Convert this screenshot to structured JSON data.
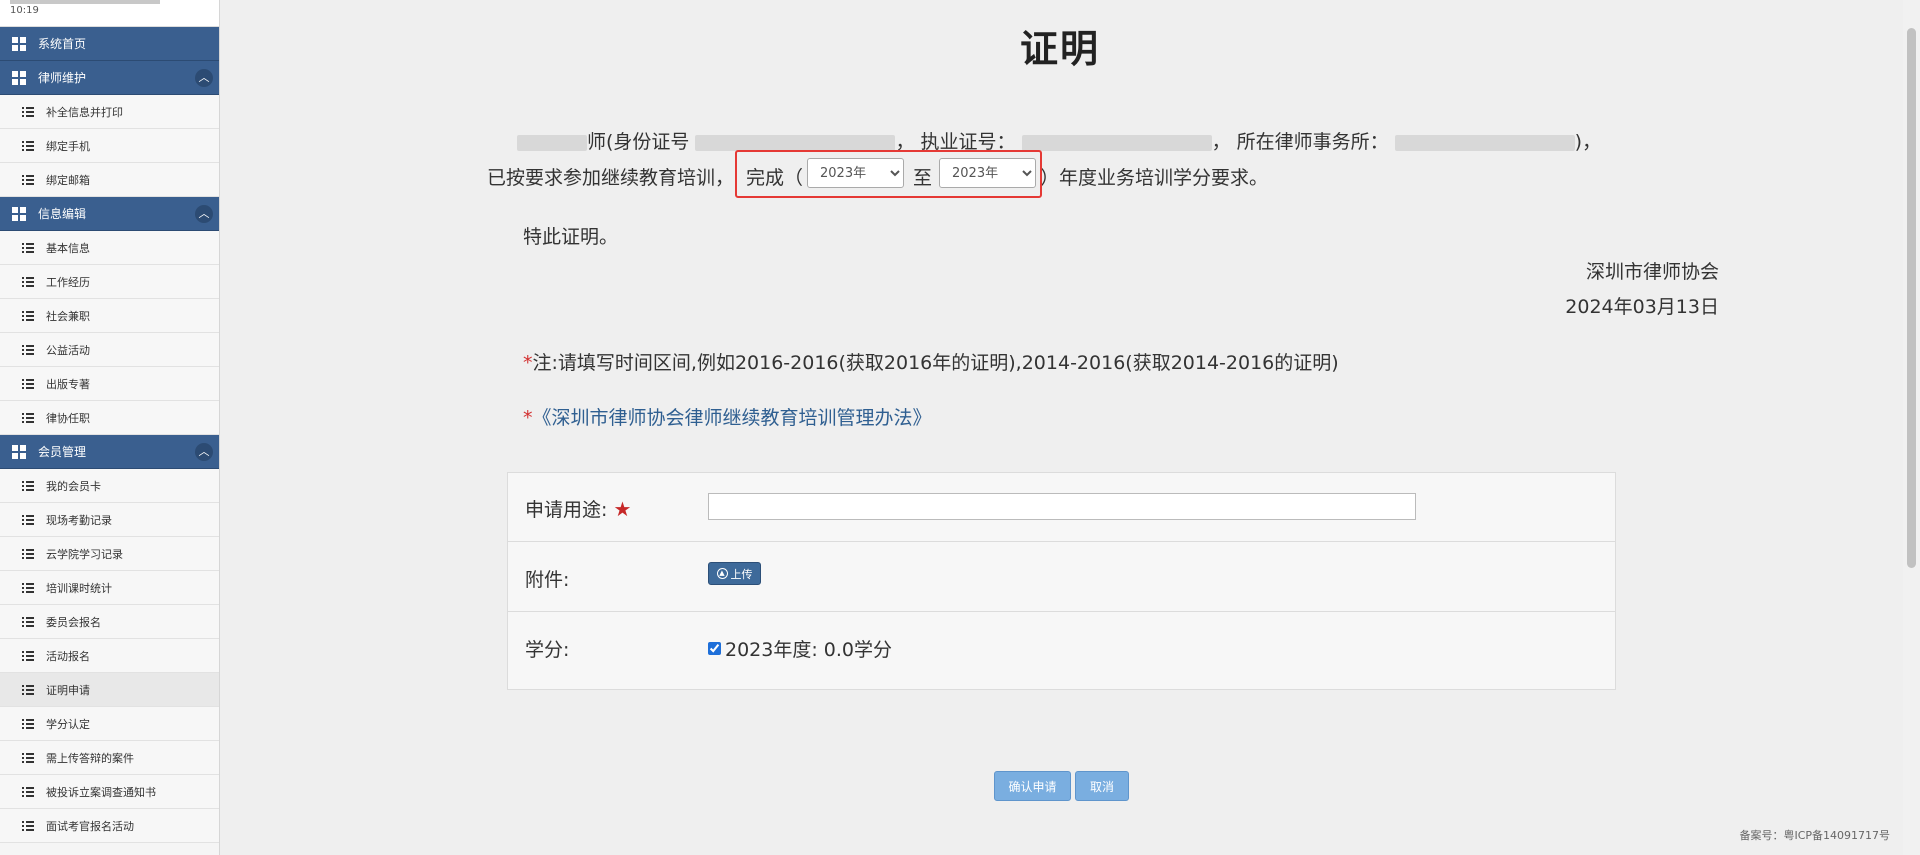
{
  "sidebar": {
    "top_time": "10:19",
    "home": "系统首页",
    "sections": [
      {
        "title": "律师维护",
        "items": [
          "补全信息并打印",
          "绑定手机",
          "绑定邮箱"
        ]
      },
      {
        "title": "信息编辑",
        "items": [
          "基本信息",
          "工作经历",
          "社会兼职",
          "公益活动",
          "出版专著",
          "律协任职"
        ]
      },
      {
        "title": "会员管理",
        "items": [
          "我的会员卡",
          "现场考勤记录",
          "云学院学习记录",
          "培训课时统计",
          "委员会报名",
          "活动报名",
          "证明申请",
          "学分认定",
          "需上传答辩的案件",
          "被投诉立案调查通知书",
          "面试考官报名活动"
        ]
      }
    ],
    "active_item": "证明申请"
  },
  "main": {
    "title": "证明",
    "line1": {
      "part_a": "师(身份证号",
      "part_b": "，  执业证号：",
      "part_c": "，  所在律师事务所：",
      "part_d": ")，"
    },
    "line2": {
      "prefix": "已按要求参加继续教育培训，",
      "complete": "完成（",
      "to": "至",
      "suffix": "）年度业务培训学分要求。"
    },
    "year_from": {
      "selected": "2023年",
      "options": [
        "2023年"
      ]
    },
    "year_to": {
      "selected": "2023年",
      "options": [
        "2023年"
      ]
    },
    "certify": "特此证明。",
    "org": "深圳市律师协会",
    "date": "2024年03月13日",
    "note_star": "*",
    "note": "注:请填写时间区间,例如2016-2016(获取2016年的证明),2014-2016(获取2014-2016的证明)",
    "link_star": "*",
    "link": "《深圳市律师协会律师继续教育培训管理办法》"
  },
  "form": {
    "purpose_label": "申请用途:",
    "purpose_value": "",
    "attachment_label": "附件:",
    "upload_label": "上传",
    "credit_label": "学分:",
    "credit_text": "2023年度: 0.0学分"
  },
  "buttons": {
    "confirm": "确认申请",
    "cancel": "取消"
  },
  "footer": "备案号：粤ICP备14091717号",
  "colors": {
    "sidebar_header": "#3a5f8f",
    "highlight": "#e53935",
    "button": "#7aaee0",
    "required": "#c62828"
  }
}
